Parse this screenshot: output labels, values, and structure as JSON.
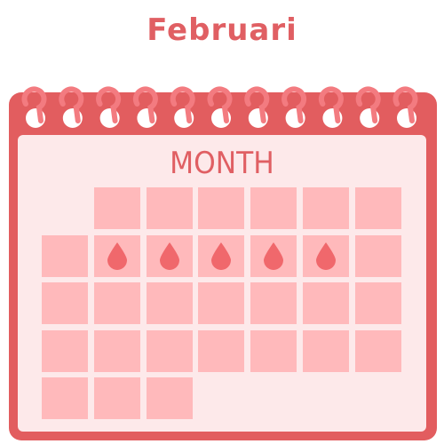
{
  "title": "Februari",
  "calendar": {
    "heading": "MONTH",
    "rows": [
      [
        "empty",
        "cell",
        "cell",
        "cell",
        "cell",
        "cell",
        "cell"
      ],
      [
        "cell",
        "drop",
        "drop",
        "drop",
        "drop",
        "drop",
        "cell"
      ],
      [
        "cell",
        "cell",
        "cell",
        "cell",
        "cell",
        "cell",
        "cell"
      ],
      [
        "cell",
        "cell",
        "cell",
        "cell",
        "cell",
        "cell",
        "cell"
      ],
      [
        "cell",
        "cell",
        "cell",
        "empty",
        "empty",
        "empty",
        "empty"
      ]
    ]
  },
  "colors": {
    "title": "#e05f63",
    "frame": "#e25d5f",
    "page": "#fde9ea",
    "cell": "#ffb9bb",
    "drop": "#f0686c",
    "heading": "#e05f63",
    "ring": "#f37b80",
    "hole": "#ffffff"
  },
  "icons": {
    "binding": "spiral-ring-icon",
    "marker": "blood-drop-icon"
  }
}
